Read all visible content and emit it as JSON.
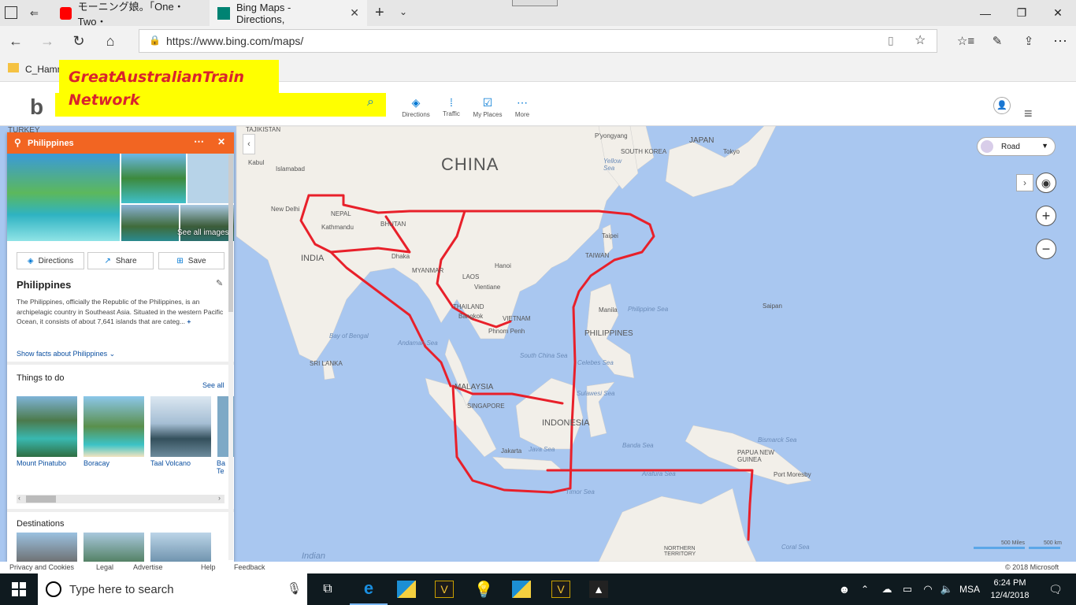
{
  "browser": {
    "tabs": [
      {
        "label": "モーニング娘。「One・Two・",
        "icon": "youtube-icon"
      },
      {
        "label": "Bing Maps - Directions,",
        "icon": "bing-icon"
      }
    ],
    "url": "https://www.bing.com/maps/",
    "favorite": "C_Hamm"
  },
  "annotation": {
    "line1": "GreatAustralianTrain",
    "line2": "Network"
  },
  "header": {
    "directions": "Directions",
    "traffic": "Traffic",
    "my_places": "My Places",
    "more": "More"
  },
  "map_controls": {
    "style_label": "Road"
  },
  "panel": {
    "title": "Philippines",
    "see_all_images": "See all images",
    "buttons": {
      "directions": "Directions",
      "share": "Share",
      "save": "Save"
    },
    "place_name": "Philippines",
    "description": "The Philippines, officially the Republic of the Philippines, is an archipelagic country in Southeast Asia. Situated in the western Pacific Ocean, it consists of about 7,641 islands that are categ...",
    "more_symbol": "+",
    "show_facts": "Show facts about Philippines",
    "things_to_do": "Things to do",
    "see_all": "See all",
    "attractions": [
      "Mount Pinatubo",
      "Boracay",
      "Taal Volcano",
      "Ba Te"
    ],
    "destinations": "Destinations"
  },
  "map_labels": {
    "china": "CHINA",
    "japan": "JAPAN",
    "india": "INDIA",
    "indonesia": "INDONESIA",
    "malaysia": "MALAYSIA",
    "myanmar": "MYANMAR",
    "thailand": "THAILAND",
    "laos": "LAOS",
    "vietnam": "VIETNAM",
    "philippines": "PHILIPPINES",
    "nepal": "NEPAL",
    "bhutan": "BHUTAN",
    "taiwan": "TAIWAN",
    "south_korea": "SOUTH KOREA",
    "png": "PAPUA NEW GUINEA",
    "turkey": "TURKEY",
    "tajikistan": "TAJIKISTAN",
    "sri_lanka": "SRI LANKA",
    "tokyo": "Tokyo",
    "taipei": "Taipei",
    "manila": "Manila",
    "hanoi": "Hanoi",
    "vientiane": "Vientiane",
    "bangkok": "Bangkok",
    "phnom_penh": "Phnom Penh",
    "singapore": "SINGAPORE",
    "jakarta": "Jakarta",
    "dhaka": "Dhaka",
    "kathmandu": "Kathmandu",
    "new_delhi": "New Delhi",
    "islamabad": "Islamabad",
    "kabul": "Kabul",
    "pyongyang": "P'yongyang",
    "port_moresby": "Port Moresby",
    "saipan": "Saipan",
    "philippine_sea": "Philippine Sea",
    "south_china_sea": "South China Sea",
    "bay_of_bengal": "Bay of Bengal",
    "andaman_sea": "Andaman Sea",
    "java_sea": "Java Sea",
    "banda_sea": "Banda Sea",
    "arafura_sea": "Arafura Sea",
    "timor_sea": "Timor Sea",
    "coral_sea": "Coral Sea",
    "bismarck_sea": "Bismarck Sea",
    "celebes_sea": "Celebes Sea",
    "sulawesi_sea": "Sulawesi Sea",
    "yellow_sea": "Yellow Sea",
    "indian": "Indian",
    "northern_territory": "NORTHERN TERRITORY",
    "scale_miles": "500 Miles",
    "scale_km": "500 km"
  },
  "footer": {
    "privacy": "Privacy and Cookies",
    "legal": "Legal",
    "advertise": "Advertise",
    "help": "Help",
    "feedback": "Feedback",
    "copyright": "© 2018 Microsoft"
  },
  "taskbar": {
    "search_placeholder": "Type here to search",
    "lang": "MSA",
    "time": "6:24 PM",
    "date": "12/4/2018"
  },
  "colors": {
    "route": "#e8202a",
    "panel_header": "#f26522",
    "annotation_bg": "#ffff00",
    "annotation_text": "#d9232d",
    "sea": "#a9c7f0",
    "land": "#f2efe9"
  }
}
